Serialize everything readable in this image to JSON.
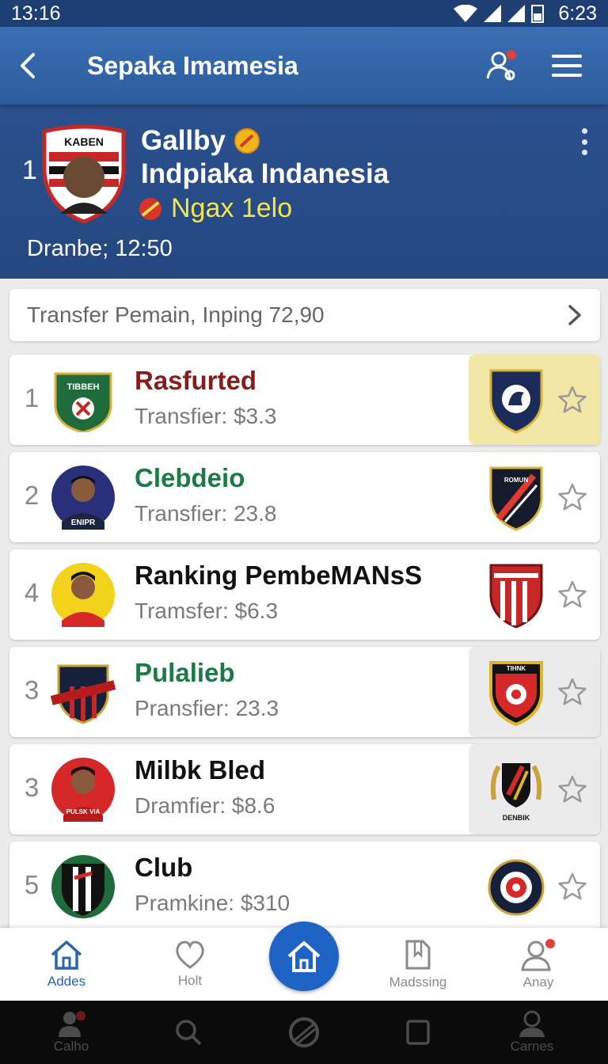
{
  "status": {
    "time_left": "13:16",
    "time_right": "6:23"
  },
  "app_bar": {
    "title": "Sepaka Imamesia"
  },
  "hero": {
    "rank": "1",
    "name": "Gallby",
    "subtitle": "Indpiaka Indanesia",
    "tag": "Ngax 1elo",
    "date": "Dranbe; 12:50",
    "crest_text": "KABEN"
  },
  "transfer_bar": {
    "text": "Transfer Pemain,  Inping 72,90"
  },
  "rows": [
    {
      "rank": "1",
      "name": "Rasfurted",
      "sub": "Transfier:  $3.3",
      "avatar_text": "TIBBEH",
      "name_color": "#8b1a1a",
      "highlight": "#f3e7a6"
    },
    {
      "rank": "2",
      "name": "Clebdeio",
      "sub": "Transfier:  23.8",
      "avatar_text": "ENIPR",
      "name_color": "#1b7a45",
      "highlight": ""
    },
    {
      "rank": "4",
      "name": "Ranking PembeMANsS",
      "sub": "Tramsfer:  $6.3",
      "avatar_text": "",
      "name_color": "#111111",
      "highlight": ""
    },
    {
      "rank": "3",
      "name": "Pulalieb",
      "sub": "Pransfier:  23.3",
      "avatar_text": "",
      "name_color": "#1b7a45",
      "highlight": "#ebebeb"
    },
    {
      "rank": "3",
      "name": "Milbk Bled",
      "sub": "Dramfier:  $8.6",
      "avatar_text": "PULSK VIA",
      "name_color": "#111111",
      "highlight": "#ebebeb"
    },
    {
      "rank": "5",
      "name": "Club",
      "sub": "Pramkine:  $310",
      "avatar_text": "",
      "name_color": "#111111",
      "highlight": ""
    }
  ],
  "crest_labels": {
    "row1": "TIBBEH",
    "row2": "ROMUN",
    "row4": "TIHNK",
    "row5": "DENBIK"
  },
  "bottom_nav": [
    {
      "label": "Addes",
      "icon": "home-icon",
      "active": true
    },
    {
      "label": "Holt",
      "icon": "heart-icon",
      "active": false
    },
    {
      "label": "",
      "icon": "home-icon",
      "active": false
    },
    {
      "label": "Madssing",
      "icon": "document-icon",
      "active": false
    },
    {
      "label": "Anay",
      "icon": "user-icon",
      "active": false
    }
  ],
  "system_nav": [
    {
      "label": "Calho",
      "icon": "lock-icon"
    },
    {
      "label": "",
      "icon": "search-icon"
    },
    {
      "label": "",
      "icon": "ball-icon"
    },
    {
      "label": "",
      "icon": "square-icon"
    },
    {
      "label": "Carnes",
      "icon": "user-icon"
    }
  ],
  "colors": {
    "primary": "#2c5c9c",
    "hero": "#244780",
    "accent_yellow": "#f4e44a",
    "nav_active": "#2a63b0"
  }
}
